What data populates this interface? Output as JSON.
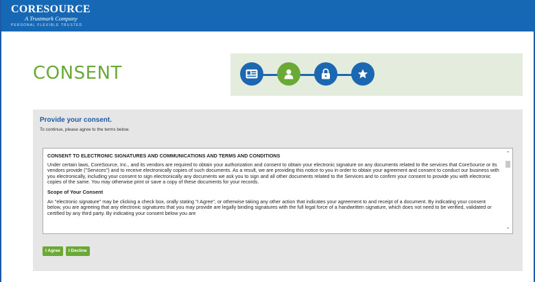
{
  "header": {
    "logo_main": "CORESOURCE",
    "logo_sub": "A Trustmark Company",
    "logo_tagline": "PERSONAL   FLEXIBLE   TRUSTED",
    "bg_color": "#1668b5"
  },
  "page": {
    "title": "CONSENT"
  },
  "progress": {
    "steps": [
      {
        "icon": "id-card-icon",
        "state": "complete"
      },
      {
        "icon": "user-icon",
        "state": "current"
      },
      {
        "icon": "lock-icon",
        "state": "pending"
      },
      {
        "icon": "star-icon",
        "state": "pending"
      }
    ],
    "colors": {
      "blue": "#1c67b2",
      "green": "#6aa935",
      "panel": "#e3ecdd"
    }
  },
  "consent": {
    "heading": "Provide your consent.",
    "instruction": "To continue, please agree to the terms below.",
    "terms": {
      "title": "CONSENT TO ELECTRONIC SIGNATURES AND COMMUNICATIONS AND TERMS AND CONDITIONS",
      "para1": "Under certain laws, CoreSource, Inc., and its vendors are required to obtain your authorization and consent to obtain your electronic signature on any documents related to the services that CoreSource or its vendors provide (\"Services\") and to receive electronically copies of such documents. As a result, we are providing this notice to you in order to obtain your agreement and consent to conduct our business with you electronically, including your consent to sign electronically any documents we ask you to sign and all other documents related to the Services and to confirm your consent to provide you with electronic copies of the same. You may otherwise print or save a copy of these documents for your records.",
      "subheading": "Scope of Your Consent",
      "para2": "An \"electronic signature\" may be clicking a check box, orally stating \"I Agree\", or otherwise taking any other action that indicates your agreement to and receipt of a document. By indicating your consent below, you are agreeing that any electronic signatures that you may provide are legally binding signatures with the full legal force of a handwritten signature, which does not need to be verified, validated or certified by any third party. By indicating your consent below you are"
    },
    "agree_label": "I Agree",
    "decline_label": "I Decline",
    "button_color": "#6aa935"
  }
}
